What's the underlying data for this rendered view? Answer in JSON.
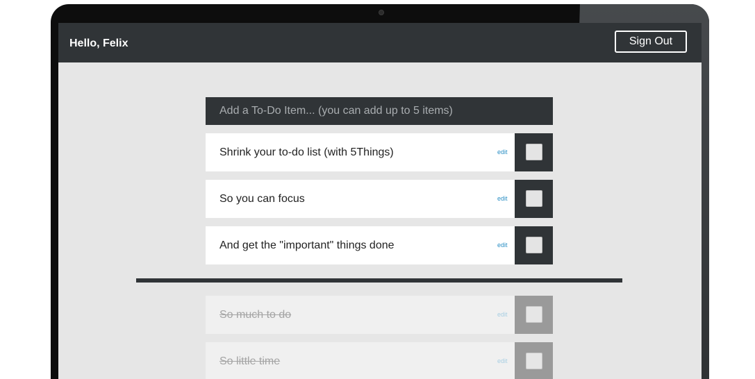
{
  "header": {
    "greeting": "Hello, Felix",
    "signout_label": "Sign Out"
  },
  "add_item": {
    "placeholder": "Add a To-Do Item... (you can add up to 5 items)"
  },
  "active_items": [
    {
      "text": "Shrink your to-do list (with 5Things)",
      "edit_label": "edit",
      "checked": false
    },
    {
      "text": "So you can focus",
      "edit_label": "edit",
      "checked": false
    },
    {
      "text": "And get the \"important\" things done",
      "edit_label": "edit",
      "checked": false
    }
  ],
  "completed_items": [
    {
      "text": "So much to do",
      "edit_label": "edit",
      "checked": true
    },
    {
      "text": "So little time",
      "edit_label": "edit",
      "checked": true
    }
  ],
  "colors": {
    "bar": "#303437",
    "background": "#e6e6e6",
    "edit_link": "#2a8fc4"
  }
}
